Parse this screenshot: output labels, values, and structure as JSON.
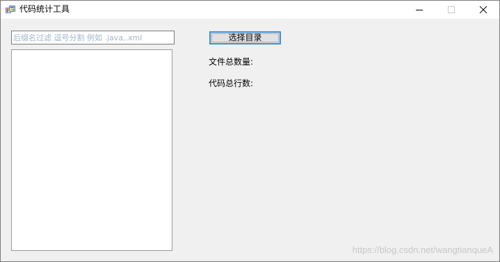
{
  "window": {
    "title": "代码统计工具",
    "app_icon": "winforms-app-icon",
    "controls": {
      "minimize_icon": "minimize-icon",
      "maximize_icon": "maximize-icon",
      "close_icon": "close-icon"
    }
  },
  "filter": {
    "value": "",
    "placeholder": "后缀名过滤 逗号分割 例如 .java,.xml"
  },
  "file_list": {
    "items": []
  },
  "actions": {
    "choose_dir_label": "选择目录"
  },
  "stats": {
    "file_count_label": "文件总数量:",
    "line_count_label": "代码总行数:"
  },
  "watermark": "https://blog.csdn.net/wangtianqueA",
  "colors": {
    "window_bg": "#f0f0f0",
    "titlebar_bg": "#ffffff",
    "button_focus_border": "#3c8fd8",
    "placeholder_text": "#9eb6c8"
  }
}
